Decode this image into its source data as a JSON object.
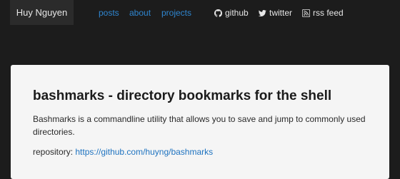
{
  "header": {
    "brand": "Huy Nguyen",
    "nav": {
      "posts": "posts",
      "about": "about",
      "projects": "projects"
    },
    "social": {
      "github": "github",
      "twitter": "twitter",
      "rss": "rss feed"
    }
  },
  "post": {
    "title": "bashmarks - directory bookmarks for the shell",
    "description": "Bashmarks is a commandline utility that allows you to save and jump to commonly used directories.",
    "repo_label": "repository:",
    "repo_url": "https://github.com/huyng/bashmarks"
  },
  "colors": {
    "background": "#1c1c1c",
    "brand_bg": "#2b2b2b",
    "nav_link": "#2f86d0",
    "card_bg": "#f5f5f5",
    "link": "#1e73c0"
  },
  "icons": {
    "github": "github-icon",
    "twitter": "twitter-icon",
    "rss": "rss-icon"
  }
}
